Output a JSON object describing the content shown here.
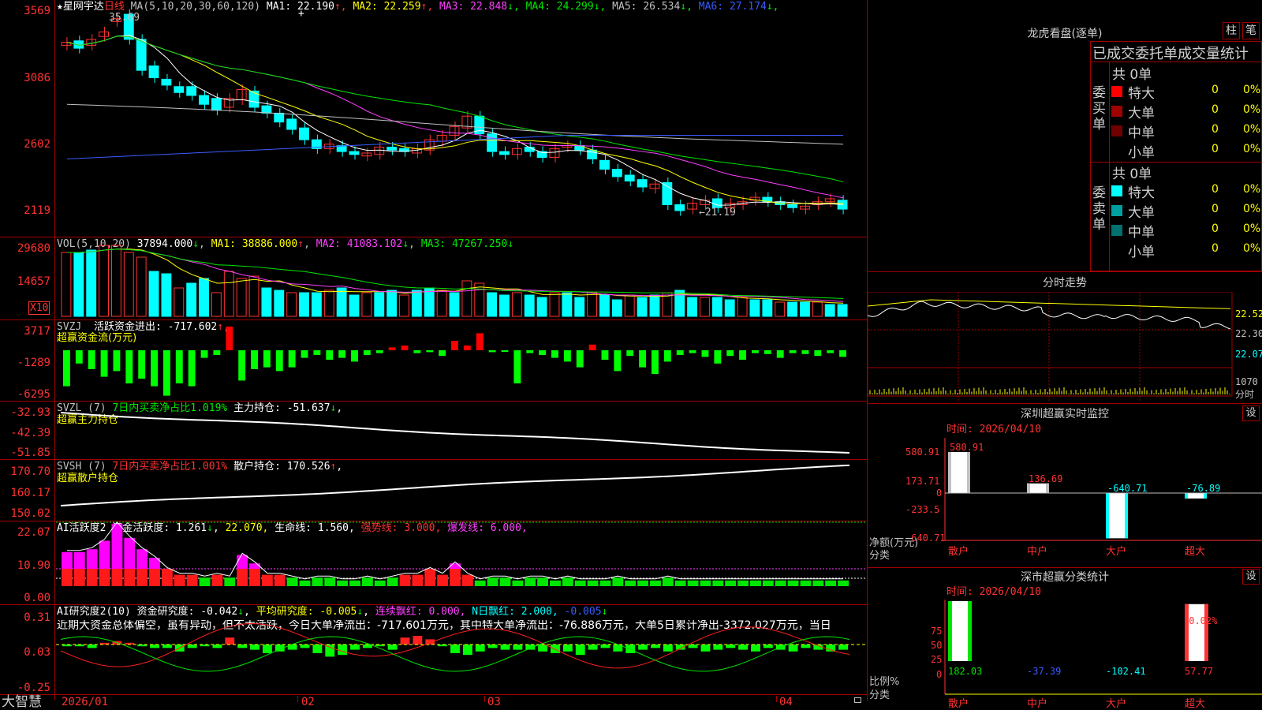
{
  "brand": "大智慧",
  "main": {
    "stock_name": "★星网宇达",
    "period": "日线",
    "ma_title": "MA(5,10,20,30,60,120)",
    "ma": [
      {
        "label": "MA1:",
        "value": "22.190",
        "arrow": "↑",
        "color": "#ffffff"
      },
      {
        "label": "MA2:",
        "value": "22.259",
        "arrow": "↑",
        "color": "#ffff00"
      },
      {
        "label": "MA3:",
        "value": "22.848",
        "arrow": "↓",
        "color": "#ff40ff"
      },
      {
        "label": "MA4:",
        "value": "24.299",
        "arrow": "↓",
        "color": "#00e600"
      },
      {
        "label": "MA5:",
        "value": "26.534",
        "arrow": "↓",
        "color": "#c0c0c0"
      },
      {
        "label": "MA6:",
        "value": "27.174",
        "arrow": "↓",
        "color": "#3a5bff"
      }
    ],
    "y_ticks": [
      "3569",
      "3086",
      "2602",
      "2119"
    ],
    "high_label": "35.69",
    "low_label": "←21.19",
    "cross": "+"
  },
  "vol": {
    "title": "VOL(5,10,20)",
    "value": "37894.000",
    "value_arrow": "↓",
    "ma1": "MA1: 38886.000",
    "ma1_arrow": "↑",
    "ma2": "MA2: 41083.102",
    "ma2_arrow": "↓",
    "ma3": "MA3: 47267.250",
    "ma3_arrow": "↓",
    "y_ticks": [
      "29680",
      "14657"
    ],
    "unit": "X10"
  },
  "svzj": {
    "title": "SVZJ",
    "label": "活跃资金进出:",
    "value": "-717.602",
    "arrow": "↑",
    "tail": ",",
    "subtitle": "超赢资金流(万元)",
    "y_ticks": [
      "3717",
      "-1289",
      "-6295"
    ]
  },
  "svzl": {
    "title": "SVZL (7)",
    "label": "7日内买卖净占比1.019%",
    "label2": "主力持仓:",
    "value": "-51.637",
    "arrow": "↓",
    "tail": ",",
    "subtitle": "超赢主力持仓",
    "y_ticks": [
      "-32.93",
      "-42.39",
      "-51.85"
    ]
  },
  "svsh": {
    "title": "SVSH (7)",
    "label": "7日内买卖净占比1.001%",
    "label2": "散户持仓:",
    "value": "170.526",
    "arrow": "↑",
    "tail": ",",
    "subtitle": "超赢散户持仓",
    "y_ticks": [
      "170.70",
      "160.17",
      "150.02"
    ]
  },
  "ai_active": {
    "title": "AI活跃度2",
    "label": "资金活跃度:",
    "value": "1.261",
    "arrow": "↓",
    "v2": "22.070,",
    "life_label": "生命线:",
    "life": "1.560,",
    "strong_label": "强势线:",
    "strong": "3.000,",
    "burst_label": "爆发线:",
    "burst": "6.000,",
    "y_ticks": [
      "22.07",
      "10.90",
      "0.00"
    ]
  },
  "ai_research": {
    "title": "AI研究度2(10)",
    "label": "资金研究度:",
    "value": "-0.042",
    "arrow": "↓",
    "avg_label": "平均研究度:",
    "avg": "-0.005",
    "avg_arrow": "↓",
    "red_label": "连续飘红:",
    "red": "0.000,",
    "nred_label": "N日飘红:",
    "nred": "2.000,",
    "last": "-0.005",
    "last_arrow": "↓",
    "comment": "近期大资金总体偏空，虽有异动，但不太活跃，今日大单净流出：-717.601万元，其中特大单净流出：-76.886万元，大单5日累计净出-3372.027万元，当日",
    "y_ticks": [
      "0.31",
      "0.03",
      "-0.25"
    ]
  },
  "x_axis": [
    "2026/01",
    "02",
    "03",
    "04"
  ],
  "longhu": {
    "title": "龙虎看盘(逐单)",
    "btn1": "柱",
    "btn2": "笔",
    "header": "已成交委托单成交量统计",
    "buy": {
      "side": "委买单",
      "total": "共 0单",
      "rows": [
        {
          "name": "特大",
          "count": "0",
          "pct": "0%",
          "color": "#ff0000"
        },
        {
          "name": "大单",
          "count": "0",
          "pct": "0%",
          "color": "#a00000"
        },
        {
          "name": "中单",
          "count": "0",
          "pct": "0%",
          "color": "#700000"
        },
        {
          "name": "小单",
          "count": "0",
          "pct": "0%",
          "color": "#000000"
        }
      ]
    },
    "sell": {
      "side": "委卖单",
      "total": "共 0单",
      "rows": [
        {
          "name": "特大",
          "count": "0",
          "pct": "0%",
          "color": "#00ffff"
        },
        {
          "name": "大单",
          "count": "0",
          "pct": "0%",
          "color": "#00a0a0"
        },
        {
          "name": "中单",
          "count": "0",
          "pct": "0%",
          "color": "#007070"
        },
        {
          "name": "小单",
          "count": "0",
          "pct": "0%",
          "color": "#000000"
        }
      ]
    }
  },
  "intraday": {
    "title": "分时走势",
    "y_ticks": [
      "22.52",
      "22.30",
      "22.07"
    ],
    "vol_tick": "1070",
    "vol_label": "分时"
  },
  "sz_monitor": {
    "title": "深圳超赢实时监控",
    "btn": "设",
    "time": "时间: 2026/04/10",
    "y_ticks": [
      "580.91",
      "173.71",
      "0",
      "-233.5",
      "-640.71"
    ],
    "ylabel1": "净额(万元)",
    "ylabel2": "分类",
    "bars": [
      {
        "cat": "散户",
        "value": "580.91",
        "num": 580.91,
        "color": "#ff3232"
      },
      {
        "cat": "中户",
        "value": "136.69",
        "num": 136.69,
        "color": "#ff3232"
      },
      {
        "cat": "大户",
        "value": "-640.71",
        "num": -640.71,
        "color": "#00ffff"
      },
      {
        "cat": "超大",
        "value": "-76.89",
        "num": -76.89,
        "color": "#00ffff"
      }
    ]
  },
  "sz_class": {
    "title": "深市超赢分类统计",
    "btn": "设",
    "time": "时间: 2026/04/10",
    "y_ticks": [
      "75",
      "50",
      "25",
      "0"
    ],
    "ylabel1": "比例%",
    "ylabel2": "分类",
    "top_label": "-0.02%",
    "bars": [
      {
        "cat": "散户",
        "value": "182.03",
        "pct": 100,
        "color": "#00e600"
      },
      {
        "cat": "中户",
        "value": "-37.39",
        "pct": 0,
        "color": "#3a5bff"
      },
      {
        "cat": "大户",
        "value": "-102.41",
        "pct": 0,
        "color": "#00ffff"
      },
      {
        "cat": "超大",
        "value": "57.77",
        "pct": 95,
        "color": "#ff3232"
      }
    ]
  },
  "colors": {
    "up": "#ff3232",
    "down": "#00ffff",
    "grid": "#a00000",
    "text": "#c0c0c0"
  }
}
